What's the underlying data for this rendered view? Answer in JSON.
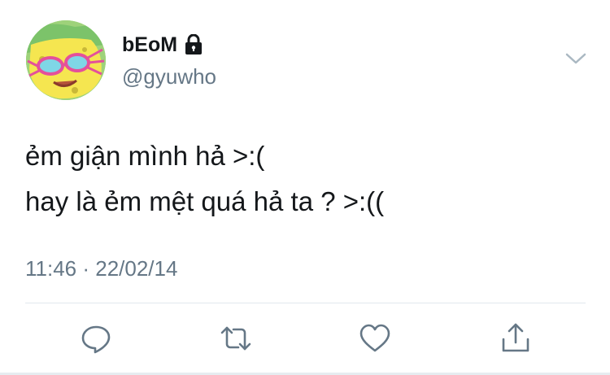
{
  "author": {
    "display_name": "bEoM",
    "handle": "@gyuwho",
    "avatar_icon": "spongebob-avatar",
    "protected_icon": "lock-icon"
  },
  "tweet": {
    "lines": [
      "ẻm giận mình hả >:(",
      "hay là ẻm mệt quá hả ta ? >:(("
    ],
    "timestamp": "11:46 · 22/02/14"
  },
  "actions": [
    {
      "icon": "reply-icon"
    },
    {
      "icon": "retweet-icon"
    },
    {
      "icon": "like-icon"
    },
    {
      "icon": "share-icon"
    }
  ],
  "colors": {
    "text": "#14171a",
    "secondary": "#657786",
    "icon": "#657786",
    "divider": "#e1e8ed"
  }
}
